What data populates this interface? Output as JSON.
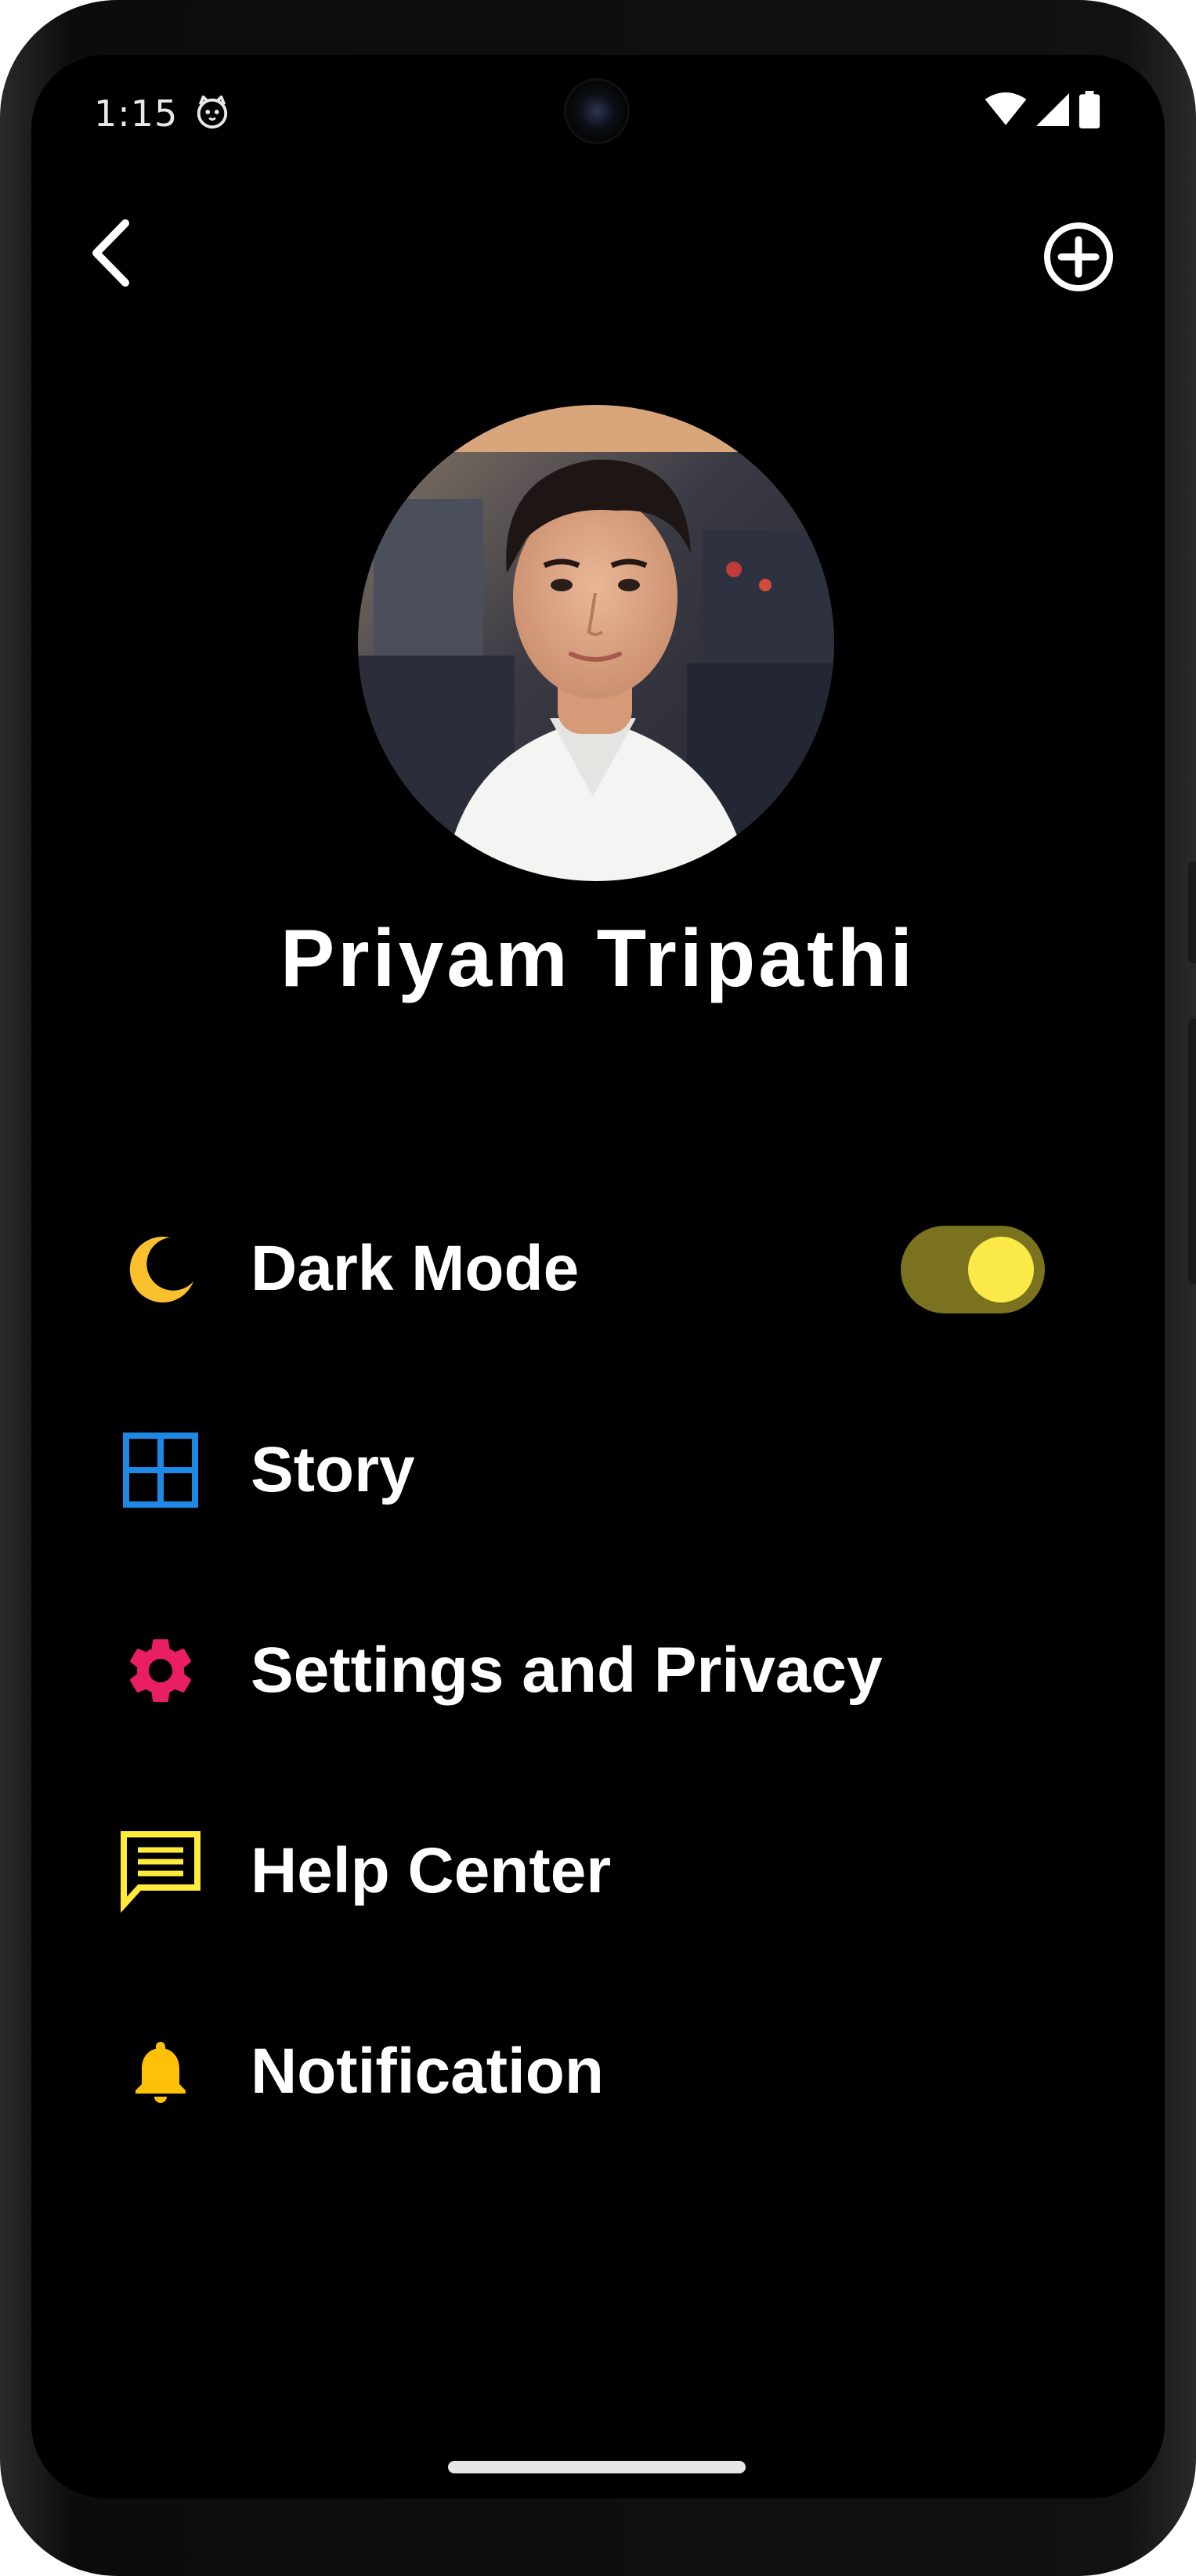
{
  "status_bar": {
    "time": "1:15"
  },
  "icons": {
    "back": "back-chevron-icon",
    "add": "add-circle-icon",
    "status_cat": "cat-face-icon",
    "wifi": "wifi-icon",
    "signal": "cell-signal-icon",
    "battery": "battery-icon"
  },
  "profile": {
    "name": "Priyam Tripathi"
  },
  "menu": {
    "items": [
      {
        "label": "Dark Mode",
        "icon": "moon-icon",
        "color": "#FBC02D"
      },
      {
        "label": "Story",
        "icon": "grid-icon",
        "color": "#1E88E5"
      },
      {
        "label": "Settings and Privacy",
        "icon": "gear-icon",
        "color": "#E91E63"
      },
      {
        "label": "Help Center",
        "icon": "message-icon",
        "color": "#FFEB3B"
      },
      {
        "label": "Notification",
        "icon": "bell-icon",
        "color": "#FFC107"
      }
    ]
  },
  "dark_mode_toggle": {
    "on": true,
    "track_color": "#7A721F",
    "knob_color": "#FBE947"
  },
  "colors": {
    "background": "#000000",
    "text": "#FFFFFF"
  }
}
